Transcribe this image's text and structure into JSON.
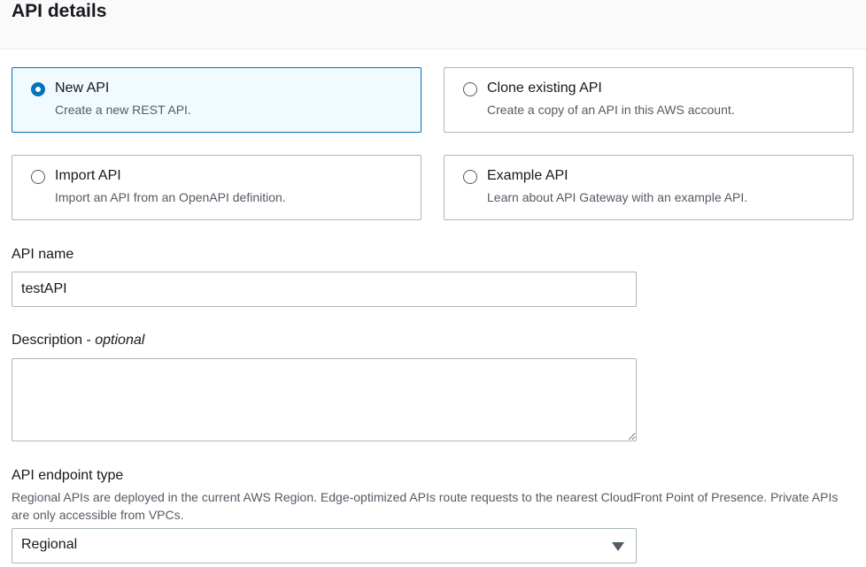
{
  "header": {
    "title": "API details"
  },
  "options": [
    {
      "title": "New API",
      "desc": "Create a new REST API.",
      "selected": true
    },
    {
      "title": "Clone existing API",
      "desc": "Create a copy of an API in this AWS account.",
      "selected": false
    },
    {
      "title": "Import API",
      "desc": "Import an API from an OpenAPI definition.",
      "selected": false
    },
    {
      "title": "Example API",
      "desc": "Learn about API Gateway with an example API.",
      "selected": false
    }
  ],
  "api_name": {
    "label": "API name",
    "value": "testAPI"
  },
  "description": {
    "label": "Description - ",
    "optional": "optional",
    "value": ""
  },
  "endpoint_type": {
    "label": "API endpoint type",
    "hint": "Regional APIs are deployed in the current AWS Region. Edge-optimized APIs route requests to the nearest CloudFront Point of Presence. Private APIs are only accessible from VPCs.",
    "value": "Regional"
  },
  "colors": {
    "accent": "#0073bb",
    "selected_bg": "#f1faff",
    "border": "#aab7b8"
  }
}
